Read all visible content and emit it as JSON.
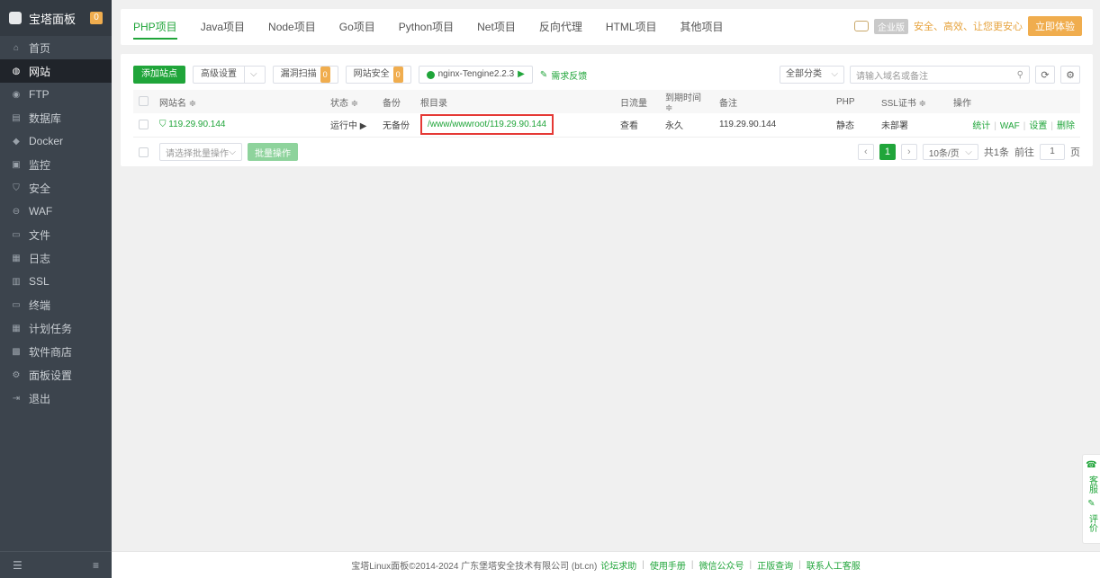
{
  "sidebar": {
    "title": "宝塔面板",
    "badge": "0",
    "items": [
      {
        "label": "首页",
        "icon": "home-icon"
      },
      {
        "label": "网站",
        "icon": "globe-icon",
        "active": true
      },
      {
        "label": "FTP",
        "icon": "ftp-icon"
      },
      {
        "label": "数据库",
        "icon": "database-icon"
      },
      {
        "label": "Docker",
        "icon": "docker-icon"
      },
      {
        "label": "监控",
        "icon": "monitor-icon"
      },
      {
        "label": "安全",
        "icon": "shield-icon"
      },
      {
        "label": "WAF",
        "icon": "waf-icon"
      },
      {
        "label": "文件",
        "icon": "folder-icon"
      },
      {
        "label": "日志",
        "icon": "log-icon"
      },
      {
        "label": "SSL",
        "icon": "ssl-icon"
      },
      {
        "label": "终端",
        "icon": "terminal-icon"
      },
      {
        "label": "计划任务",
        "icon": "calendar-icon"
      },
      {
        "label": "软件商店",
        "icon": "store-icon"
      },
      {
        "label": "面板设置",
        "icon": "gear-icon"
      },
      {
        "label": "退出",
        "icon": "logout-icon"
      }
    ]
  },
  "tabs": [
    {
      "label": "PHP项目",
      "active": true
    },
    {
      "label": "Java项目"
    },
    {
      "label": "Node项目"
    },
    {
      "label": "Go项目"
    },
    {
      "label": "Python项目"
    },
    {
      "label": "Net项目"
    },
    {
      "label": "反向代理"
    },
    {
      "label": "HTML项目"
    },
    {
      "label": "其他项目"
    }
  ],
  "promo": {
    "badge": "企业版",
    "slogan": "安全、高效、让您更安心",
    "button": "立即体验"
  },
  "toolbar": {
    "add_site": "添加站点",
    "advanced": "高级设置",
    "vuln_scan": "漏洞扫描",
    "vuln_badge": "0",
    "site_security": "网站安全",
    "security_badge": "0",
    "nginx": "nginx-Tengine2.2.3",
    "feedback": "需求反馈",
    "category": "全部分类",
    "search_placeholder": "请输入域名或备注"
  },
  "table": {
    "headers": {
      "name": "网站名 ≑",
      "status": "状态 ≑",
      "backup": "备份",
      "root": "根目录",
      "traffic": "日流量",
      "expire": "到期时间 ≑",
      "note": "备注",
      "php": "PHP",
      "ssl": "SSL证书 ≑",
      "action": "操作"
    },
    "rows": [
      {
        "name": "119.29.90.144",
        "status": "运行中 ▶",
        "backup": "无备份",
        "root": "/www/wwwroot/119.29.90.144",
        "traffic": "查看",
        "expire": "永久",
        "note": "119.29.90.144",
        "php": "静态",
        "ssl": "未部署",
        "actions": [
          "统计",
          "WAF",
          "设置",
          "删除"
        ]
      }
    ]
  },
  "batch": {
    "placeholder": "请选择批量操作",
    "button": "批量操作"
  },
  "pager": {
    "current": "1",
    "page_size": "10条/页",
    "total": "共1条",
    "goto_label": "前往",
    "goto_value": "1",
    "page_unit": "页"
  },
  "footer": {
    "copyright": "宝塔Linux面板©2014-2024 广东堡塔安全技术有限公司 (bt.cn)",
    "links": [
      "论坛求助",
      "使用手册",
      "微信公众号",
      "正版查询",
      "联系人工客服"
    ]
  },
  "side_widget": {
    "service": "客服",
    "review": "评价"
  },
  "colors": {
    "accent": "#20a53a",
    "sidebar_bg": "#3c444d",
    "warning": "#f0ad4e",
    "highlight_border": "#e53935"
  }
}
